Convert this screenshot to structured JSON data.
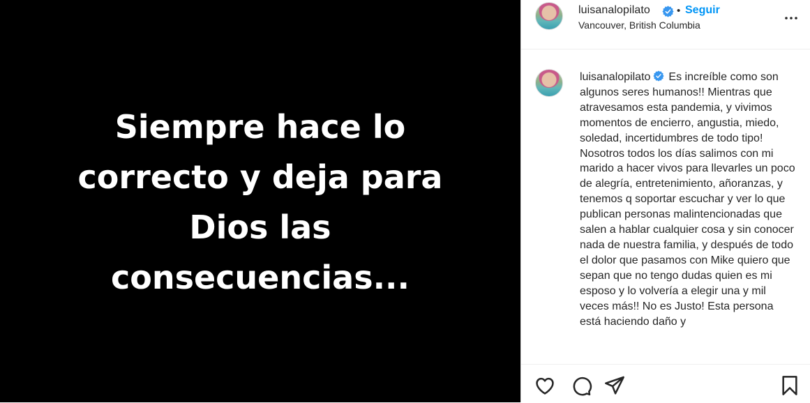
{
  "post": {
    "image_text": "Siempre hace lo correcto y deja para Dios las consecuencias..."
  },
  "header": {
    "username": "luisanalopilato",
    "separator": "•",
    "follow_label": "Seguir",
    "location": "Vancouver, British Columbia"
  },
  "caption": {
    "username": "luisanalopilato",
    "text": "Es increíble como son algunos seres humanos!! Mientras que atravesamos esta pandemia, y vivimos momentos de encierro, angustia, miedo, soledad, incertidumbres de todo tipo! Nosotros todos los días salimos con mi marido a hacer vivos para llevarles un poco de alegría, entretenimiento, añoranzas, y tenemos q soportar escuchar y ver lo que publican personas malintencionadas que salen a hablar cualquier cosa y sin conocer nada de nuestra familia, y después de todo el dolor que pasamos con Mike quiero que sepan que no tengo dudas quien es mi esposo y lo volvería a elegir una y mil veces más!! No es Justo! Esta persona está haciendo daño y"
  },
  "icons": {
    "verified": "verified-badge-icon",
    "more": "more-options-icon",
    "like": "heart-icon",
    "comment": "comment-icon",
    "share": "share-icon",
    "save": "bookmark-icon"
  },
  "colors": {
    "verified": "#3897f0",
    "follow": "#0095f6",
    "text": "#262626",
    "media_bg": "#000000"
  }
}
